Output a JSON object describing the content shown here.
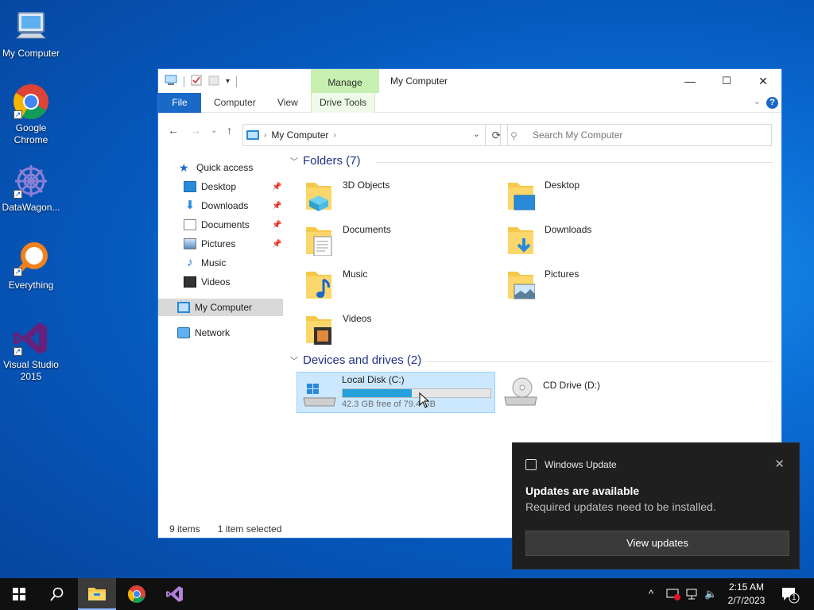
{
  "desktop": {
    "icons": [
      {
        "label": "My Computer"
      },
      {
        "label": "Google Chrome"
      },
      {
        "label": "DataWagon..."
      },
      {
        "label": "Everything"
      },
      {
        "label": "Visual Studio 2015"
      }
    ]
  },
  "window": {
    "title": "My Computer",
    "context_tab_header": "Manage",
    "ribbon_tabs": [
      "File",
      "Computer",
      "View",
      "Drive Tools"
    ],
    "minimize": "—",
    "maximize": "☐",
    "close": "✕",
    "address": {
      "location": "My Computer"
    },
    "search": {
      "placeholder": "Search My Computer"
    },
    "nav_pane": {
      "quick_access": "Quick access",
      "items": [
        "Desktop",
        "Downloads",
        "Documents",
        "Pictures",
        "Music",
        "Videos"
      ],
      "this_pc": "My Computer",
      "network": "Network"
    },
    "folders_header": "Folders (7)",
    "folders": [
      "3D Objects",
      "Desktop",
      "Documents",
      "Downloads",
      "Music",
      "Pictures",
      "Videos"
    ],
    "drives_header": "Devices and drives (2)",
    "drives": [
      {
        "label": "Local Disk (C:)",
        "free_text": "42.3 GB free of 79.4 GB",
        "used_fraction": 0.467
      },
      {
        "label": "CD Drive (D:)"
      }
    ],
    "status": {
      "items": "9 items",
      "selected": "1 item selected"
    }
  },
  "toast": {
    "app": "Windows Update",
    "title": "Updates are available",
    "body": "Required updates need to be installed.",
    "button": "View updates"
  },
  "taskbar": {
    "time": "2:15 AM",
    "date": "2/7/2023",
    "notification_count": "1"
  },
  "colors": {
    "accent": "#1a68c7",
    "selection": "#cce8ff",
    "drive_bar": "#26a0da",
    "context_tab": "#c6efb0"
  }
}
